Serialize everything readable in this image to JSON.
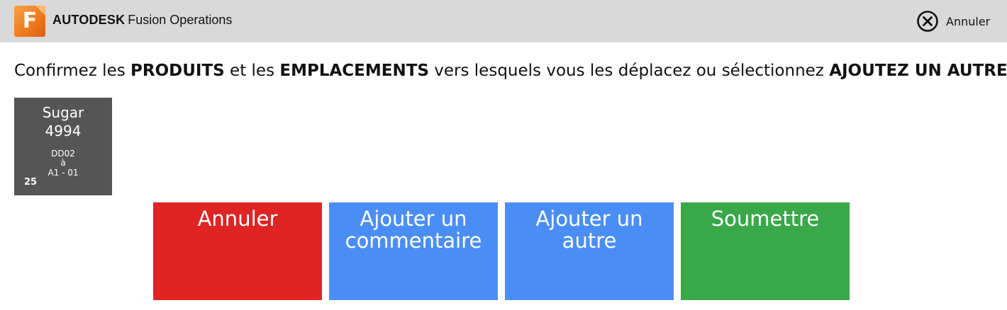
{
  "header": {
    "logo_letter": "F",
    "brand_bold": "AUTODESK",
    "brand_product": "Fusion Operations",
    "cancel_label": "Annuler",
    "cancel_icon": "circle-x-icon",
    "logo_color": "#f47a1f",
    "background": "#d9d9d9"
  },
  "instruction": {
    "part1": "Confirmez les ",
    "bold1": "PRODUITS",
    "part2": " et les ",
    "bold2": "EMPLACEMENTS",
    "part3": " vers lesquels vous les déplacez ou sélectionnez ",
    "bold3": "AJOUTEZ UN AUTRE",
    "part4": ":"
  },
  "products": [
    {
      "name": "Sugar",
      "number": "4994",
      "from_location": "DD02",
      "arrow_text": "à",
      "to_location": "A1 - 01",
      "quantity": "25",
      "color": "#555555"
    }
  ],
  "actions": {
    "cancel": {
      "line1": "Annuler",
      "line2": "",
      "color": "#e02424"
    },
    "comment": {
      "line1": "Ajouter un",
      "line2": "commentaire",
      "color": "#4a8ef5"
    },
    "another": {
      "line1": "Ajouter un",
      "line2": "autre",
      "color": "#4a8ef5"
    },
    "submit": {
      "line1": "Soumettre",
      "line2": "",
      "color": "#38a849"
    }
  }
}
